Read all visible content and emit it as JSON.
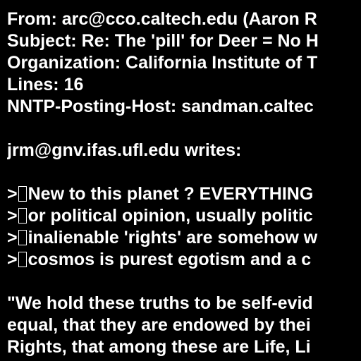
{
  "header": {
    "from": "From: arc@cco.caltech.edu (Aaron R",
    "subject": "Subject: Re: The 'pill' for Deer = No H",
    "organization": "Organization: California Institute of T",
    "lines": "Lines: 16",
    "nntp_host": "NNTP-Posting-Host: sandman.caltec"
  },
  "attribution": "jrm@gnv.ifas.ufl.edu writes:",
  "quoted": [
    {
      "marker": ">",
      "text": "New to this planet ? EVERYTHING"
    },
    {
      "marker": ">",
      "text": "or political opinion, usually politic"
    },
    {
      "marker": ">",
      "text": "inalienable 'rights' are somehow w"
    },
    {
      "marker": ">",
      "text": "cosmos is purest egotism and a c"
    }
  ],
  "body": [
    "\"We hold these truths to be self-evid",
    "equal, that they are endowed by thei",
    "Rights, that among these are Life, Li"
  ],
  "colors": {
    "background": "#000000",
    "text": "#ffffff"
  }
}
